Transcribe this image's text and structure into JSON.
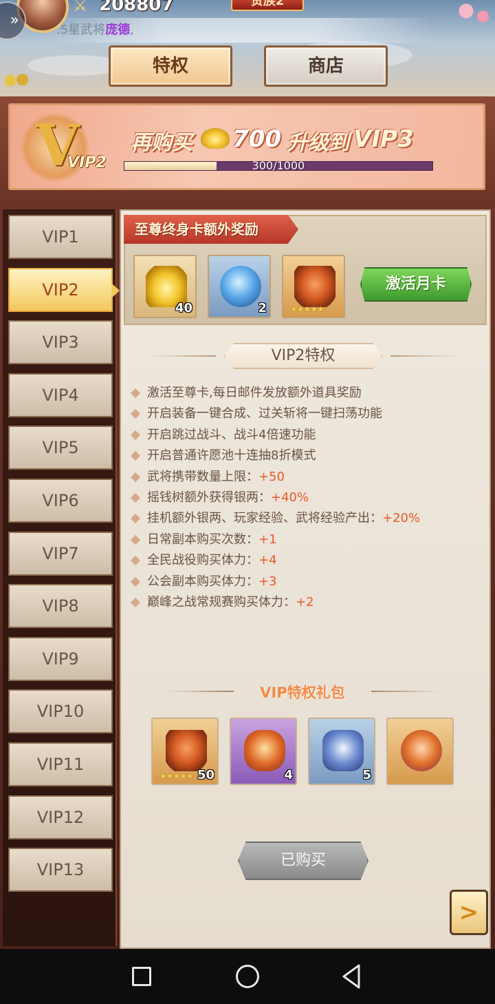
{
  "header": {
    "power_value": "208807",
    "rank_badge": "贵族2",
    "notice_prefix": ".5星武将",
    "notice_highlight": "庞德",
    "notice_suffix": ","
  },
  "tabs": [
    {
      "label": "特权",
      "active": true
    },
    {
      "label": "商店",
      "active": false
    }
  ],
  "banner": {
    "vip_badge": "VIP2",
    "upgrade_prefix": "再购买",
    "upgrade_amount": "700",
    "upgrade_suffix": "升级到",
    "upgrade_target": "VIP3",
    "progress_text": "300/1000",
    "progress_fraction": 0.3
  },
  "sidebar": {
    "active_index": 1,
    "items": [
      "VIP1",
      "VIP2",
      "VIP3",
      "VIP4",
      "VIP5",
      "VIP6",
      "VIP7",
      "VIP8",
      "VIP9",
      "VIP10",
      "VIP11",
      "VIP12",
      "VIP13"
    ]
  },
  "supreme_card": {
    "ribbon": "至尊终身卡额外奖励",
    "items": [
      {
        "icon": "gold-ingot-icon",
        "qty": "40"
      },
      {
        "icon": "blue-orb-icon",
        "qty": "2"
      },
      {
        "icon": "red-helmet-icon",
        "qty": "",
        "stars": "★★★★★"
      }
    ],
    "activate_button": "激活月卡"
  },
  "privileges": {
    "title": "VIP2特权",
    "items": [
      {
        "text": "激活至尊卡,每日邮件发放额外道具奖励",
        "bonus": ""
      },
      {
        "text": "开启装备一键合成、过关斩将一键扫荡功能",
        "bonus": ""
      },
      {
        "text": "开启跳过战斗、战斗4倍速功能",
        "bonus": ""
      },
      {
        "text": "开启普通许愿池十连抽8折模式",
        "bonus": ""
      },
      {
        "text": "武将携带数量上限：",
        "bonus": "+50"
      },
      {
        "text": "摇钱树额外获得银两：",
        "bonus": "+40%"
      },
      {
        "text": "挂机额外银两、玩家经验、武将经验产出：",
        "bonus": "+20%"
      },
      {
        "text": "日常副本购买次数：",
        "bonus": "+1"
      },
      {
        "text": "全民战役购买体力：",
        "bonus": "+4"
      },
      {
        "text": "公会副本购买体力：",
        "bonus": "+3"
      },
      {
        "text": "巅峰之战常规赛购买体力：",
        "bonus": "+2"
      }
    ]
  },
  "gift_pack": {
    "title": "VIP特权礼包",
    "items": [
      {
        "icon": "red-helmet-icon",
        "qty": "50",
        "stars": "★★★★★"
      },
      {
        "icon": "red-token-icon",
        "qty": "4"
      },
      {
        "icon": "blue-shield-icon",
        "qty": "5"
      },
      {
        "icon": "bronze-medal-icon",
        "qty": ""
      }
    ],
    "button": "已购买"
  },
  "next_button": ">",
  "colors": {
    "accent_red": "#e85a2a",
    "active_tab": "#f2c85c",
    "activate_green": "#3f9a2e"
  }
}
